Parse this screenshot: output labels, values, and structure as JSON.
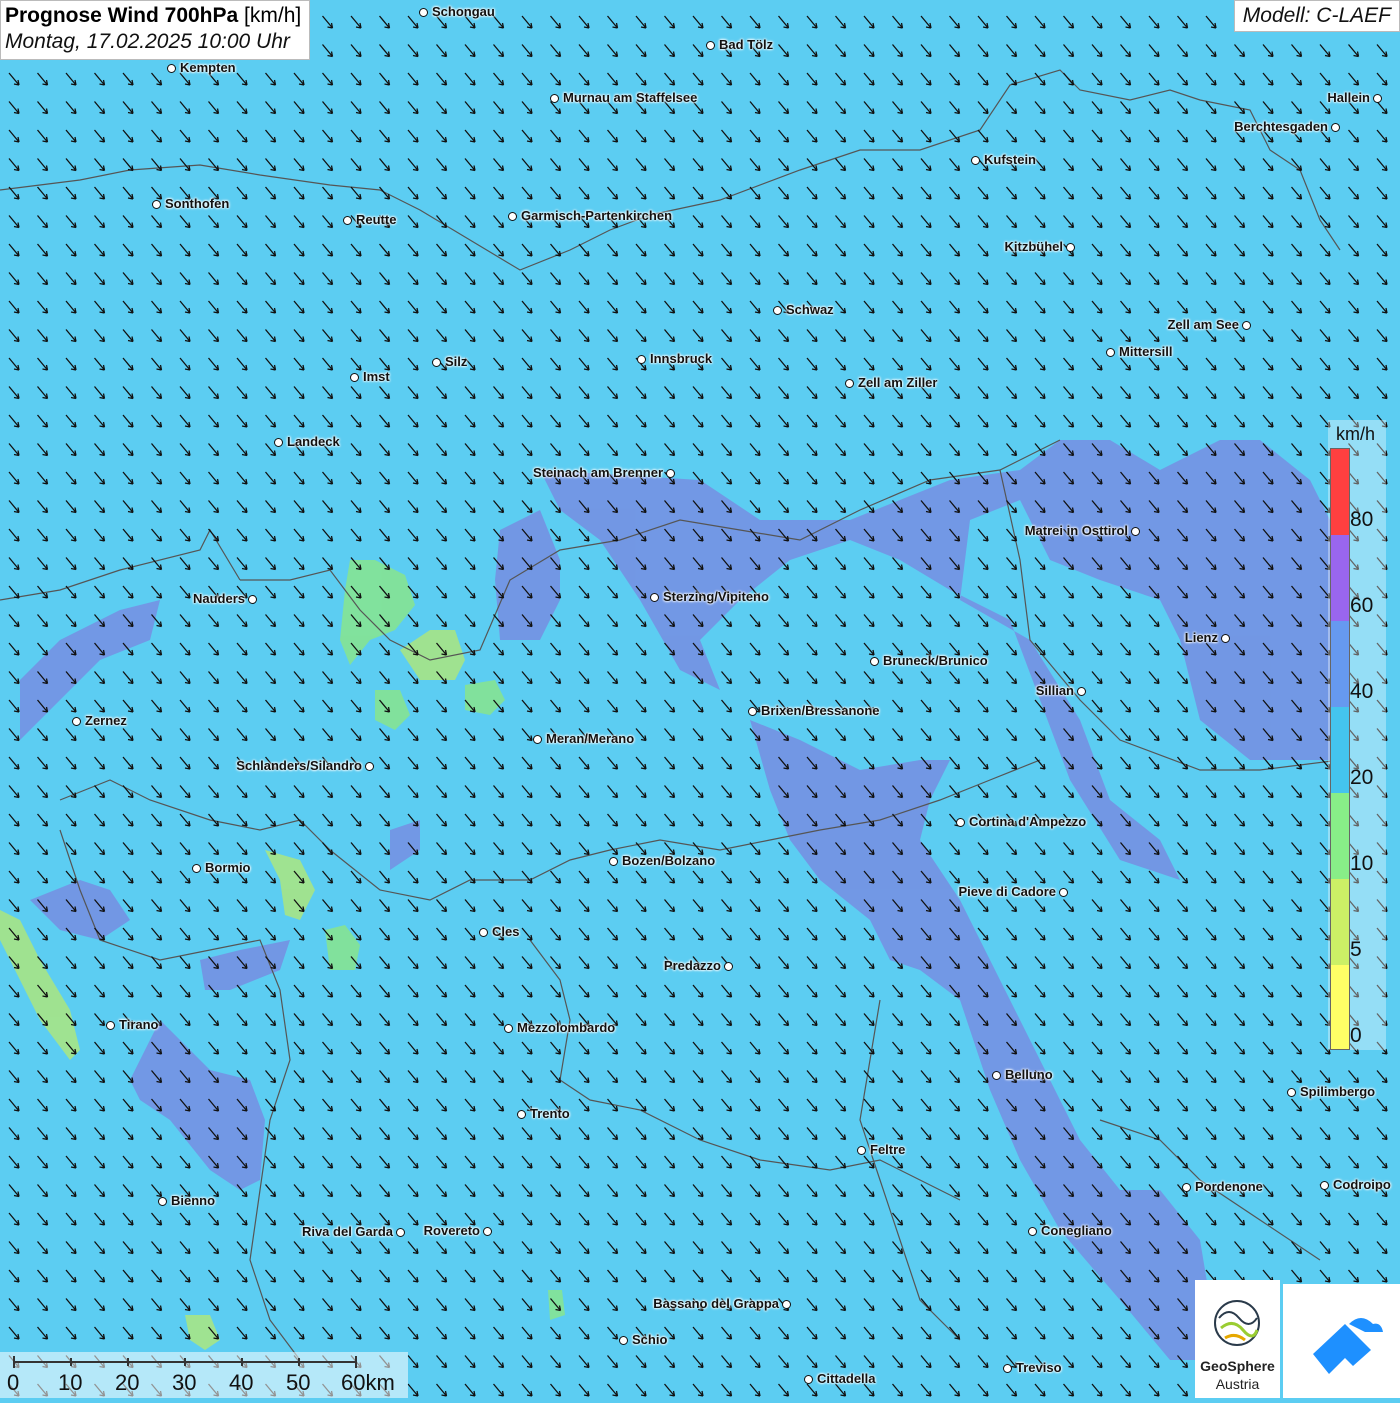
{
  "header": {
    "title_bold": "Prognose Wind 700hPa",
    "title_unit": "[km/h]",
    "datetime": "Montag, 17.02.2025 10:00 Uhr",
    "model": "Modell: C-LAEF"
  },
  "cities": [
    {
      "name": "Schongau",
      "label": "Schongau"
    },
    {
      "name": "Kempten",
      "label": "Kempten"
    },
    {
      "name": "Bad Tölz",
      "label": "Bad Tölz"
    },
    {
      "name": "Murnau",
      "label": "Murnau am Staffelsee"
    },
    {
      "name": "Hallein",
      "label": "Hallein"
    },
    {
      "name": "Berchtesgaden",
      "label": "Berchtesgaden"
    },
    {
      "name": "Kufstein",
      "label": "Kufstein"
    },
    {
      "name": "Sonthofen",
      "label": "Sonthofen"
    },
    {
      "name": "Reutte",
      "label": "Reutte"
    },
    {
      "name": "Garmisch",
      "label": "Garmisch-Partenkirchen"
    },
    {
      "name": "Kitzbühel",
      "label": "Kitzbühel"
    },
    {
      "name": "Schwaz",
      "label": "Schwaz"
    },
    {
      "name": "Zell am See",
      "label": "Zell am See"
    },
    {
      "name": "Innsbruck",
      "label": "Innsbruck"
    },
    {
      "name": "Silz",
      "label": "Silz"
    },
    {
      "name": "Imst",
      "label": "Imst"
    },
    {
      "name": "Mittersill",
      "label": "Mittersill"
    },
    {
      "name": "Zell am Ziller",
      "label": "Zell am Ziller"
    },
    {
      "name": "Landeck",
      "label": "Landeck"
    },
    {
      "name": "Steinach",
      "label": "Steinach am Brenner"
    },
    {
      "name": "Matrei",
      "label": "Matrei in Osttirol"
    },
    {
      "name": "Nauders",
      "label": "Nauders"
    },
    {
      "name": "Sterzing",
      "label": "Sterzing/Vipiteno"
    },
    {
      "name": "Lienz",
      "label": "Lienz"
    },
    {
      "name": "Bruneck",
      "label": "Bruneck/Brunico"
    },
    {
      "name": "Sillian",
      "label": "Sillian"
    },
    {
      "name": "Zernez",
      "label": "Zernez"
    },
    {
      "name": "Brixen",
      "label": "Brixen/Bressanone"
    },
    {
      "name": "Meran",
      "label": "Meran/Merano"
    },
    {
      "name": "Schlanders",
      "label": "Schlanders/Silandro"
    },
    {
      "name": "Cortina",
      "label": "Cortina d'Ampezzo"
    },
    {
      "name": "Bormio",
      "label": "Bormio"
    },
    {
      "name": "Bozen",
      "label": "Bozen/Bolzano"
    },
    {
      "name": "Pieve di Cadore",
      "label": "Pieve di Cadore"
    },
    {
      "name": "Cles",
      "label": "Cles"
    },
    {
      "name": "Predazzo",
      "label": "Predazzo"
    },
    {
      "name": "Tirano",
      "label": "Tirano"
    },
    {
      "name": "Mezzolombardo",
      "label": "Mezzolombardo"
    },
    {
      "name": "Belluno",
      "label": "Belluno"
    },
    {
      "name": "Spilimbergo",
      "label": "Spilimbergo"
    },
    {
      "name": "Trento",
      "label": "Trento"
    },
    {
      "name": "Feltre",
      "label": "Feltre"
    },
    {
      "name": "Bienno",
      "label": "Bienno"
    },
    {
      "name": "Pordenone",
      "label": "Pordenone"
    },
    {
      "name": "Codroipo",
      "label": "Codroipo"
    },
    {
      "name": "Riva",
      "label": "Riva del Garda"
    },
    {
      "name": "Rovereto",
      "label": "Rovereto"
    },
    {
      "name": "Conegliano",
      "label": "Conegliano"
    },
    {
      "name": "Bassano",
      "label": "Bassano del Grappa"
    },
    {
      "name": "Schio",
      "label": "Schio"
    },
    {
      "name": "Treviso",
      "label": "Treviso"
    },
    {
      "name": "Cittadella",
      "label": "Cittadella"
    }
  ],
  "legend": {
    "unit": "km/h",
    "ticks": [
      "80",
      "60",
      "40",
      "20",
      "10",
      "5",
      "0"
    ],
    "colors": [
      "#ff4040",
      "#9966ee",
      "#6699f0",
      "#44c4ee",
      "#88ee88",
      "#ccf066",
      "#ffff66"
    ]
  },
  "scale": {
    "labels": [
      "0",
      "10",
      "20",
      "30",
      "40",
      "50",
      "60km"
    ]
  },
  "logos": {
    "geosphere_line1": "GeoSphere",
    "geosphere_line2": "Austria"
  },
  "wind_direction": "north-west to south-east"
}
